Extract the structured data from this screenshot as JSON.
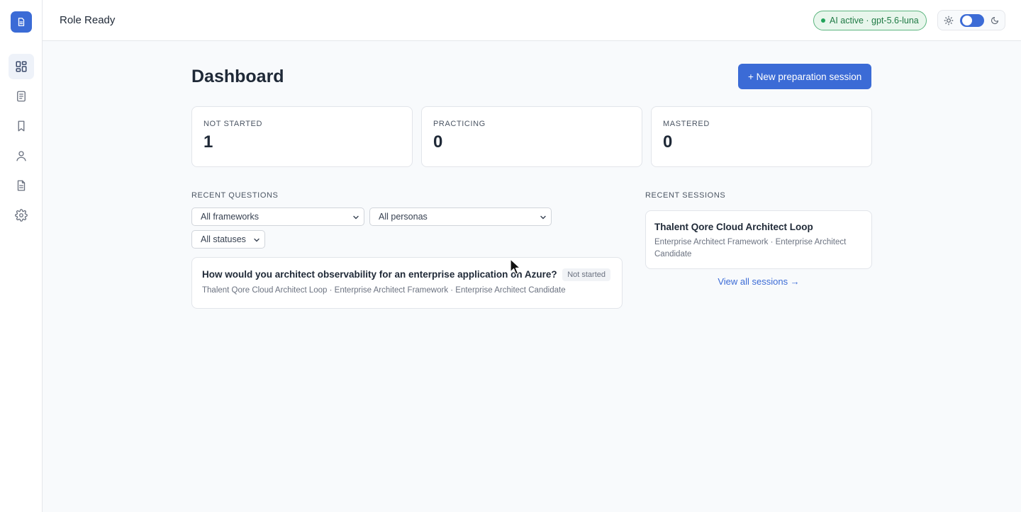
{
  "app": {
    "title": "Role Ready",
    "logo_icon": "document-icon"
  },
  "sidebar": {
    "items": [
      {
        "name": "dashboard",
        "icon": "grid-icon",
        "active": true
      },
      {
        "name": "questions",
        "icon": "document-list-icon",
        "active": false
      },
      {
        "name": "bookmarks",
        "icon": "bookmark-icon",
        "active": false
      },
      {
        "name": "personas",
        "icon": "user-icon",
        "active": false
      },
      {
        "name": "documents",
        "icon": "file-text-icon",
        "active": false
      },
      {
        "name": "settings",
        "icon": "gear-icon",
        "active": false
      }
    ]
  },
  "topbar": {
    "ai_status": "AI active · gpt-5.6-luna",
    "theme": {
      "left_icon": "sun-icon",
      "right_icon": "moon-icon",
      "dark_mode": false
    }
  },
  "dashboard": {
    "title": "Dashboard",
    "new_session_label": "+ New preparation session",
    "stats": [
      {
        "label": "NOT STARTED",
        "value": "1"
      },
      {
        "label": "PRACTICING",
        "value": "0"
      },
      {
        "label": "MASTERED",
        "value": "0"
      }
    ],
    "recent_questions": {
      "label": "RECENT QUESTIONS",
      "filters": {
        "frameworks": "All frameworks",
        "personas": "All personas",
        "statuses": "All statuses"
      },
      "items": [
        {
          "text": "How would you architect observability for an enterprise application on Azure?",
          "meta": "Thalent Qore Cloud Architect Loop · Enterprise Architect Framework · Enterprise Architect Candidate",
          "status": "Not started"
        }
      ]
    },
    "recent_sessions": {
      "label": "RECENT SESSIONS",
      "items": [
        {
          "title": "Thalent Qore Cloud Architect Loop",
          "meta": "Enterprise Architect Framework · Enterprise Architect Candidate"
        }
      ],
      "view_all": "View all sessions →"
    }
  },
  "colors": {
    "accent": "#3b6bd6",
    "ai_green": "#22a35a",
    "background": "#f8fafc"
  }
}
